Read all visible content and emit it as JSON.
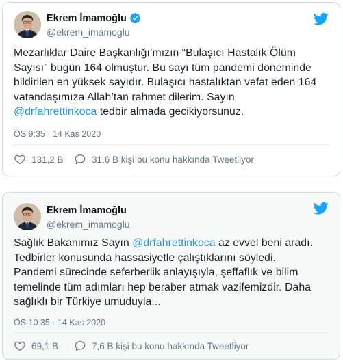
{
  "tweets": [
    {
      "author": {
        "display_name": "Ekrem İmamoğlu",
        "handle": "@ekrem_imamoglu",
        "verified": true
      },
      "lines": [
        [
          {
            "text": "Mezarlıklar Daire Başkanlığı’mızın “Bulaşıcı Hastalık Ölüm"
          }
        ],
        [
          {
            "text": "Sayısı” bugün 164 olmuştur. Bu sayı tüm pandemi döneminde"
          }
        ],
        [
          {
            "text": "bildirilen en yüksek sayıdır. Bulaşıcı hastalıktan vefat eden 164"
          }
        ],
        [
          {
            "text": "vatandaşımıza Allah’tan rahmet dilerim. Sayın"
          }
        ],
        [
          {
            "text": "@drfahrettinkoca",
            "mention": true
          },
          {
            "text": " tedbir almada gecikiyorsunuz."
          }
        ]
      ],
      "timestamp": "ÖS 9:35 · 14 Kas 2020",
      "likes": "131,2 B",
      "discussion": "31,6 B kişi bu konu hakkında Tweetliyor"
    },
    {
      "author": {
        "display_name": "Ekrem İmamoğlu",
        "handle": "@ekrem_imamoglu",
        "verified": false
      },
      "lines": [
        [
          {
            "text": "Sağlık Bakanımız Sayın "
          },
          {
            "text": "@drfahrettinkoca",
            "mention": true
          },
          {
            "text": " az evvel beni aradı."
          }
        ],
        [
          {
            "text": "Tedbirler konusunda hassasiyetle çalıştıklarını söyledi."
          }
        ],
        [
          {
            "text": "Pandemi sürecinde seferberlik anlayışıyla, şeffaflık ve bilim"
          }
        ],
        [
          {
            "text": "temelinde tüm adımları hep beraber atmak vazifemizdir. Daha"
          }
        ],
        [
          {
            "text": "sağlıklı bir Türkiye umuduyla..."
          }
        ]
      ],
      "timestamp": "ÖS 10:35 · 14 Kas 2020",
      "likes": "69,1 B",
      "discussion": "7,6 B kişi bu konu hakkında Tweetliyor"
    }
  ],
  "icons": {
    "verified": "verified-badge-icon",
    "bird": "twitter-bird-icon",
    "like": "heart-icon",
    "discussion": "speech-bubble-icon"
  },
  "colors": {
    "accent": "#1da1f2",
    "mention": "#1b95e0",
    "muted": "#657786",
    "border": "#cfd9de"
  }
}
